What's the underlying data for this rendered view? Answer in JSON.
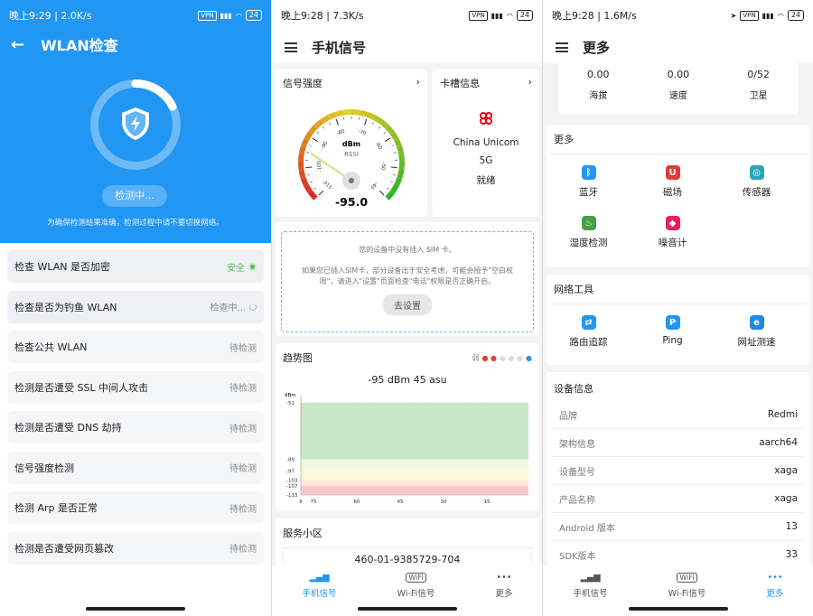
{
  "phone1": {
    "status": {
      "time": "晚上9:29 | 2.0K/s",
      "battery": "24"
    },
    "title": "WLAN检查",
    "detect_label": "检测中...",
    "tip": "为确保检测结果准确，检测过程中请不要切换网络。",
    "items": [
      {
        "label": "检查 WLAN 是否加密",
        "status": "安全"
      },
      {
        "label": "检查是否为钓鱼 WLAN",
        "status": "检查中..."
      },
      {
        "label": "检查公共 WLAN",
        "status": "待检测"
      },
      {
        "label": "检测是否遭受 SSL 中间人攻击",
        "status": "待检测"
      },
      {
        "label": "检测是否遭受 DNS 劫持",
        "status": "待检测"
      },
      {
        "label": "信号强度检测",
        "status": "待检测"
      },
      {
        "label": "检测 Arp 是否正常",
        "status": "待检测"
      },
      {
        "label": "检测是否遭受网页篡改",
        "status": "待检测"
      }
    ]
  },
  "phone2": {
    "status": {
      "time": "晚上9:28 | 7.3K/s",
      "battery": "24"
    },
    "title": "手机信号",
    "signal_card_title": "信号强度",
    "gauge": {
      "unit": "dBm",
      "sub": "RSSI",
      "value": "-95.0",
      "ticks": [
        "-110",
        "-100",
        "-90",
        "-80",
        "-70",
        "-60",
        "-50",
        "-40"
      ],
      "reading": -95
    },
    "sim_card_title": "卡槽信息",
    "carrier": "China Unicom",
    "network": "5G",
    "state": "就绪",
    "sim_notice": "您的设备中没有插入 SIM 卡。",
    "sim_detail": "如果您已插入SIM卡，部分设备出于安全考虑，可能会授予\"空白权限\"，请进入\"设置\"页面检查\"电话\"权限是否正确开启。",
    "settings_btn": "去设置",
    "trend_title": "趋势图",
    "trend_weak": "弱",
    "trend_reading": "-95 dBm  45 asu",
    "cell_title": "服务小区",
    "cell_id": "460-01-9385729-704",
    "chart_data": {
      "type": "area",
      "ylabel": "dBm",
      "y_ticks": [
        -51,
        -89,
        -97,
        -103,
        -107,
        -113
      ],
      "x_ticks": [
        "9",
        "75",
        "60",
        "45",
        "30",
        "15"
      ],
      "bands": [
        {
          "from": -51,
          "to": -89,
          "color": "#c8e6c9"
        },
        {
          "from": -89,
          "to": -97,
          "color": "#f1f8e0"
        },
        {
          "from": -97,
          "to": -103,
          "color": "#fff8d8"
        },
        {
          "from": -103,
          "to": -107,
          "color": "#ffe6dc"
        },
        {
          "from": -107,
          "to": -113,
          "color": "#f7c9cf"
        }
      ]
    }
  },
  "phone3": {
    "status": {
      "time": "晚上9:28 | 1.6M/s",
      "battery": "24"
    },
    "title": "更多",
    "stats": [
      {
        "value": "0.00",
        "label": "海拔"
      },
      {
        "value": "0.00",
        "label": "速度"
      },
      {
        "value": "0/52",
        "label": "卫星"
      }
    ],
    "more_title": "更多",
    "more_items": [
      {
        "label": "蓝牙",
        "icon": "bluetooth-icon",
        "color": "#2196f3",
        "glyph": "ᛒ"
      },
      {
        "label": "磁场",
        "icon": "magnet-icon",
        "color": "#e53935",
        "glyph": "U"
      },
      {
        "label": "传感器",
        "icon": "sensor-icon",
        "color": "#26a6b8",
        "glyph": "◎"
      },
      {
        "label": "湿度检测",
        "icon": "humidity-icon",
        "color": "#43a047",
        "glyph": "♨"
      },
      {
        "label": "噪音计",
        "icon": "noise-icon",
        "color": "#e91e63",
        "glyph": "◆"
      }
    ],
    "tools_title": "网络工具",
    "tools_items": [
      {
        "label": "路由追踪",
        "icon": "route-icon",
        "color": "#2196f3",
        "glyph": "⇄"
      },
      {
        "label": "Ping",
        "icon": "ping-icon",
        "color": "#2196f3",
        "glyph": "P"
      },
      {
        "label": "网址测速",
        "icon": "speedtest-icon",
        "color": "#1e88e5",
        "glyph": "e"
      }
    ],
    "device_title": "设备信息",
    "device": [
      {
        "k": "品牌",
        "v": "Redmi"
      },
      {
        "k": "架构信息",
        "v": "aarch64"
      },
      {
        "k": "设备型号",
        "v": "xaga"
      },
      {
        "k": "产品名称",
        "v": "xaga"
      },
      {
        "k": "Android 版本",
        "v": "13"
      },
      {
        "k": "SDK版本",
        "v": "33"
      }
    ]
  },
  "nav": {
    "tab1": "手机信号",
    "tab2": "Wi-Fi信号",
    "tab3": "更多"
  },
  "colors": {
    "primary": "#2196f3",
    "safe": "#5cb85c"
  }
}
